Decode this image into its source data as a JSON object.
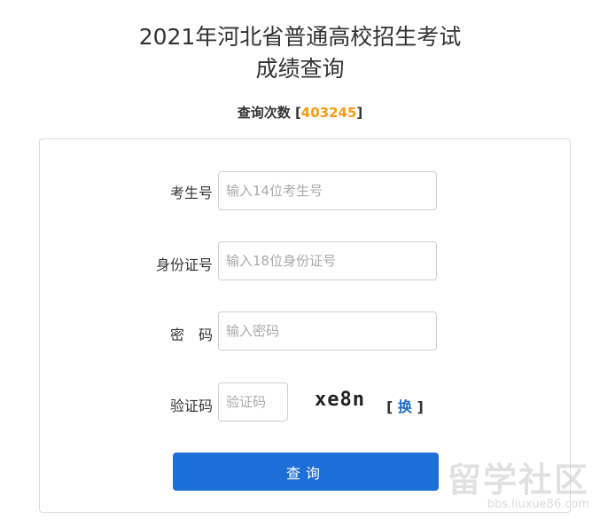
{
  "header": {
    "title_line1": "2021年河北省普通高校招生考试",
    "title_line2": "成绩查询"
  },
  "counter": {
    "label": "查询次数 [",
    "value": "403245",
    "suffix": "]"
  },
  "form": {
    "exam_id": {
      "label": "考生号",
      "placeholder": "输入14位考生号",
      "value": ""
    },
    "id_card": {
      "label": "身份证号",
      "placeholder": "输入18位身份证号",
      "value": ""
    },
    "password": {
      "label": "密　码",
      "placeholder": "输入密码",
      "value": ""
    },
    "captcha": {
      "label": "验证码",
      "placeholder": "验证码",
      "value": "",
      "image_text": "xe8n"
    },
    "refresh": {
      "open": "[ ",
      "label": "换",
      "close": " ]"
    },
    "submit_label": "查询"
  },
  "watermark": {
    "brand": "留学社区",
    "url": "bbs.liuxue86.com"
  },
  "colors": {
    "accent": "#1c6fd7",
    "counter_number": "#f39c12"
  }
}
